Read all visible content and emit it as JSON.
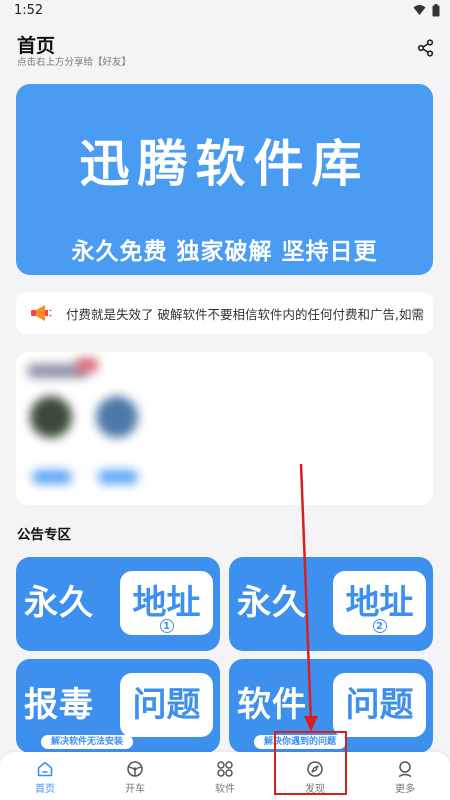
{
  "status_bar": {
    "time": "1:52"
  },
  "header": {
    "title": "首页",
    "subtitle": "点击右上方分享给【好友】"
  },
  "banner": {
    "title": "迅腾软件库",
    "slogan": "永久免费 独家破解 坚持日更"
  },
  "notice": {
    "text": "付费就是失效了  破解软件不要相信软件内的任何付费和广告,如需"
  },
  "announcements": {
    "section_title": "公告专区",
    "tiles": [
      {
        "left": "永久",
        "box": "地址",
        "num": "1"
      },
      {
        "left": "永久",
        "box": "地址",
        "num": "2"
      },
      {
        "left": "报毒",
        "box": "问题",
        "caption": "解决软件无法安装"
      },
      {
        "left": "软件",
        "box": "问题",
        "caption": "解决你遇到的问题"
      }
    ]
  },
  "bottom_nav": {
    "items": [
      {
        "label": "首页",
        "icon": "home-icon",
        "active": true
      },
      {
        "label": "开车",
        "icon": "steering-wheel-icon"
      },
      {
        "label": "软件",
        "icon": "apps-grid-icon"
      },
      {
        "label": "发现",
        "icon": "compass-icon"
      },
      {
        "label": "更多",
        "icon": "person-icon"
      }
    ]
  },
  "colors": {
    "accent": "#3e90ef",
    "banner": "#4a9cf2",
    "annotation": "#d81f1f"
  }
}
